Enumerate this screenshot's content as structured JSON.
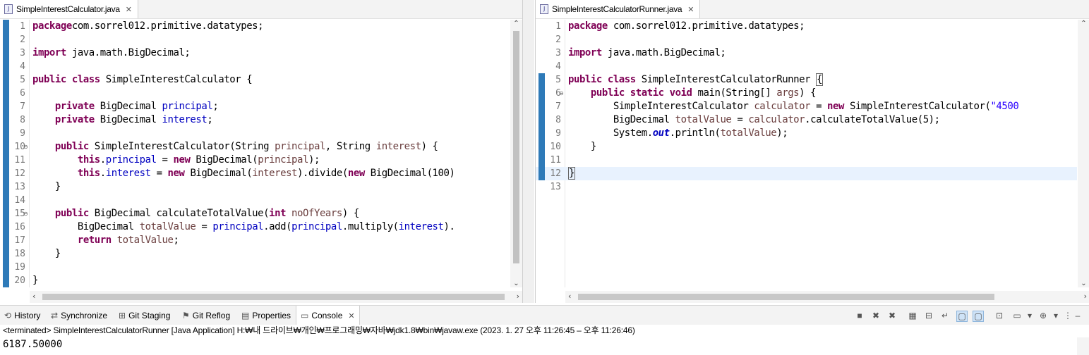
{
  "editors": {
    "left": {
      "tab_title": "SimpleInterestCalculator.java",
      "lines": [
        {
          "num": "1",
          "segs": [
            [
              "kw",
              "package"
            ],
            [
              "",
              "com.sorrel012.primitive.datatypes;"
            ]
          ]
        },
        {
          "num": "2",
          "segs": []
        },
        {
          "num": "3",
          "segs": [
            [
              "kw",
              "import"
            ],
            [
              "",
              " java.math.BigDecimal;"
            ]
          ]
        },
        {
          "num": "4",
          "segs": []
        },
        {
          "num": "5",
          "segs": [
            [
              "kw",
              "public class"
            ],
            [
              "",
              " SimpleInterestCalculator {"
            ]
          ]
        },
        {
          "num": "6",
          "segs": []
        },
        {
          "num": "7",
          "segs": [
            [
              "",
              "    "
            ],
            [
              "kw",
              "private"
            ],
            [
              "",
              " BigDecimal "
            ],
            [
              "fld",
              "principal"
            ],
            [
              "",
              ";"
            ]
          ]
        },
        {
          "num": "8",
          "segs": [
            [
              "",
              "    "
            ],
            [
              "kw",
              "private"
            ],
            [
              "",
              " BigDecimal "
            ],
            [
              "fld",
              "interest"
            ],
            [
              "",
              ";"
            ]
          ]
        },
        {
          "num": "9",
          "segs": []
        },
        {
          "num": "10",
          "fold": true,
          "segs": [
            [
              "",
              "    "
            ],
            [
              "kw",
              "public"
            ],
            [
              "",
              " SimpleInterestCalculator(String "
            ],
            [
              "par",
              "principal"
            ],
            [
              "",
              ", String "
            ],
            [
              "par",
              "interest"
            ],
            [
              "",
              ") {"
            ]
          ]
        },
        {
          "num": "11",
          "segs": [
            [
              "",
              "        "
            ],
            [
              "kw",
              "this"
            ],
            [
              "",
              "."
            ],
            [
              "fld",
              "principal"
            ],
            [
              "",
              " = "
            ],
            [
              "kw",
              "new"
            ],
            [
              "",
              " BigDecimal("
            ],
            [
              "par",
              "principal"
            ],
            [
              "",
              ");"
            ]
          ]
        },
        {
          "num": "12",
          "segs": [
            [
              "",
              "        "
            ],
            [
              "kw",
              "this"
            ],
            [
              "",
              "."
            ],
            [
              "fld",
              "interest"
            ],
            [
              "",
              " = "
            ],
            [
              "kw",
              "new"
            ],
            [
              "",
              " BigDecimal("
            ],
            [
              "par",
              "interest"
            ],
            [
              "",
              ").divide("
            ],
            [
              "kw",
              "new"
            ],
            [
              "",
              " BigDecimal(100)"
            ]
          ]
        },
        {
          "num": "13",
          "segs": [
            [
              "",
              "    }"
            ]
          ]
        },
        {
          "num": "14",
          "segs": []
        },
        {
          "num": "15",
          "fold": true,
          "segs": [
            [
              "",
              "    "
            ],
            [
              "kw",
              "public"
            ],
            [
              "",
              " BigDecimal calculateTotalValue("
            ],
            [
              "kw",
              "int"
            ],
            [
              "",
              " "
            ],
            [
              "par",
              "noOfYears"
            ],
            [
              "",
              ") {"
            ]
          ]
        },
        {
          "num": "16",
          "segs": [
            [
              "",
              "        BigDecimal "
            ],
            [
              "lvar",
              "totalValue"
            ],
            [
              "",
              " = "
            ],
            [
              "fld",
              "principal"
            ],
            [
              "",
              ".add("
            ],
            [
              "fld",
              "principal"
            ],
            [
              "",
              ".multiply("
            ],
            [
              "fld",
              "interest"
            ],
            [
              "",
              ")."
            ]
          ]
        },
        {
          "num": "17",
          "segs": [
            [
              "",
              "        "
            ],
            [
              "kw",
              "return"
            ],
            [
              "",
              " "
            ],
            [
              "lvar",
              "totalValue"
            ],
            [
              "",
              ";"
            ]
          ]
        },
        {
          "num": "18",
          "segs": [
            [
              "",
              "    }"
            ]
          ]
        },
        {
          "num": "19",
          "segs": []
        },
        {
          "num": "20",
          "segs": [
            [
              "",
              "}"
            ]
          ]
        }
      ]
    },
    "right": {
      "tab_title": "SimpleInterestCalculatorRunner.java",
      "lines": [
        {
          "num": "1",
          "segs": [
            [
              "kw",
              "package"
            ],
            [
              "",
              " com.sorrel012.primitive.datatypes;"
            ]
          ]
        },
        {
          "num": "2",
          "segs": []
        },
        {
          "num": "3",
          "segs": [
            [
              "kw",
              "import"
            ],
            [
              "",
              " java.math.BigDecimal;"
            ]
          ]
        },
        {
          "num": "4",
          "segs": []
        },
        {
          "num": "5",
          "segs": [
            [
              "kw",
              "public class"
            ],
            [
              "",
              " SimpleInterestCalculatorRunner "
            ],
            [
              "cursor",
              "{"
            ]
          ]
        },
        {
          "num": "6",
          "fold": true,
          "segs": [
            [
              "",
              "    "
            ],
            [
              "kw",
              "public static void"
            ],
            [
              "",
              " main(String[] "
            ],
            [
              "par",
              "args"
            ],
            [
              "",
              ") {"
            ]
          ]
        },
        {
          "num": "7",
          "segs": [
            [
              "",
              "        SimpleInterestCalculator "
            ],
            [
              "lvar",
              "calculator"
            ],
            [
              "",
              " = "
            ],
            [
              "kw",
              "new"
            ],
            [
              "",
              " SimpleInterestCalculator("
            ],
            [
              "str",
              "\"4500"
            ]
          ]
        },
        {
          "num": "8",
          "segs": [
            [
              "",
              "        BigDecimal "
            ],
            [
              "lvar",
              "totalValue"
            ],
            [
              "",
              " = "
            ],
            [
              "lvar",
              "calculator"
            ],
            [
              "",
              ".calculateTotalValue(5);"
            ]
          ]
        },
        {
          "num": "9",
          "segs": [
            [
              "",
              "        System."
            ],
            [
              "sfld",
              "out"
            ],
            [
              "",
              ".println("
            ],
            [
              "lvar",
              "totalValue"
            ],
            [
              "",
              ");"
            ]
          ]
        },
        {
          "num": "10",
          "segs": [
            [
              "",
              "    }"
            ]
          ]
        },
        {
          "num": "11",
          "segs": []
        },
        {
          "num": "12",
          "highlight": true,
          "segs": [
            [
              "cursor",
              "}"
            ]
          ]
        },
        {
          "num": "13",
          "segs": []
        }
      ]
    }
  },
  "bottom_panel": {
    "tabs": [
      {
        "label": "History",
        "icon": "history-icon"
      },
      {
        "label": "Synchronize",
        "icon": "synchronize-icon"
      },
      {
        "label": "Git Staging",
        "icon": "git-staging-icon"
      },
      {
        "label": "Git Reflog",
        "icon": "git-reflog-icon"
      },
      {
        "label": "Properties",
        "icon": "properties-icon"
      },
      {
        "label": "Console",
        "icon": "console-icon",
        "active": true
      }
    ],
    "console_status": "<terminated> SimpleInterestCalculatorRunner [Java Application] H:₩내 드라이브₩개인₩프로그래밍₩자바₩jdk1.8₩bin₩javaw.exe  (2023. 1. 27 오후 11:26:45 – 오후 11:26:46)",
    "console_output": "6187.50000"
  }
}
